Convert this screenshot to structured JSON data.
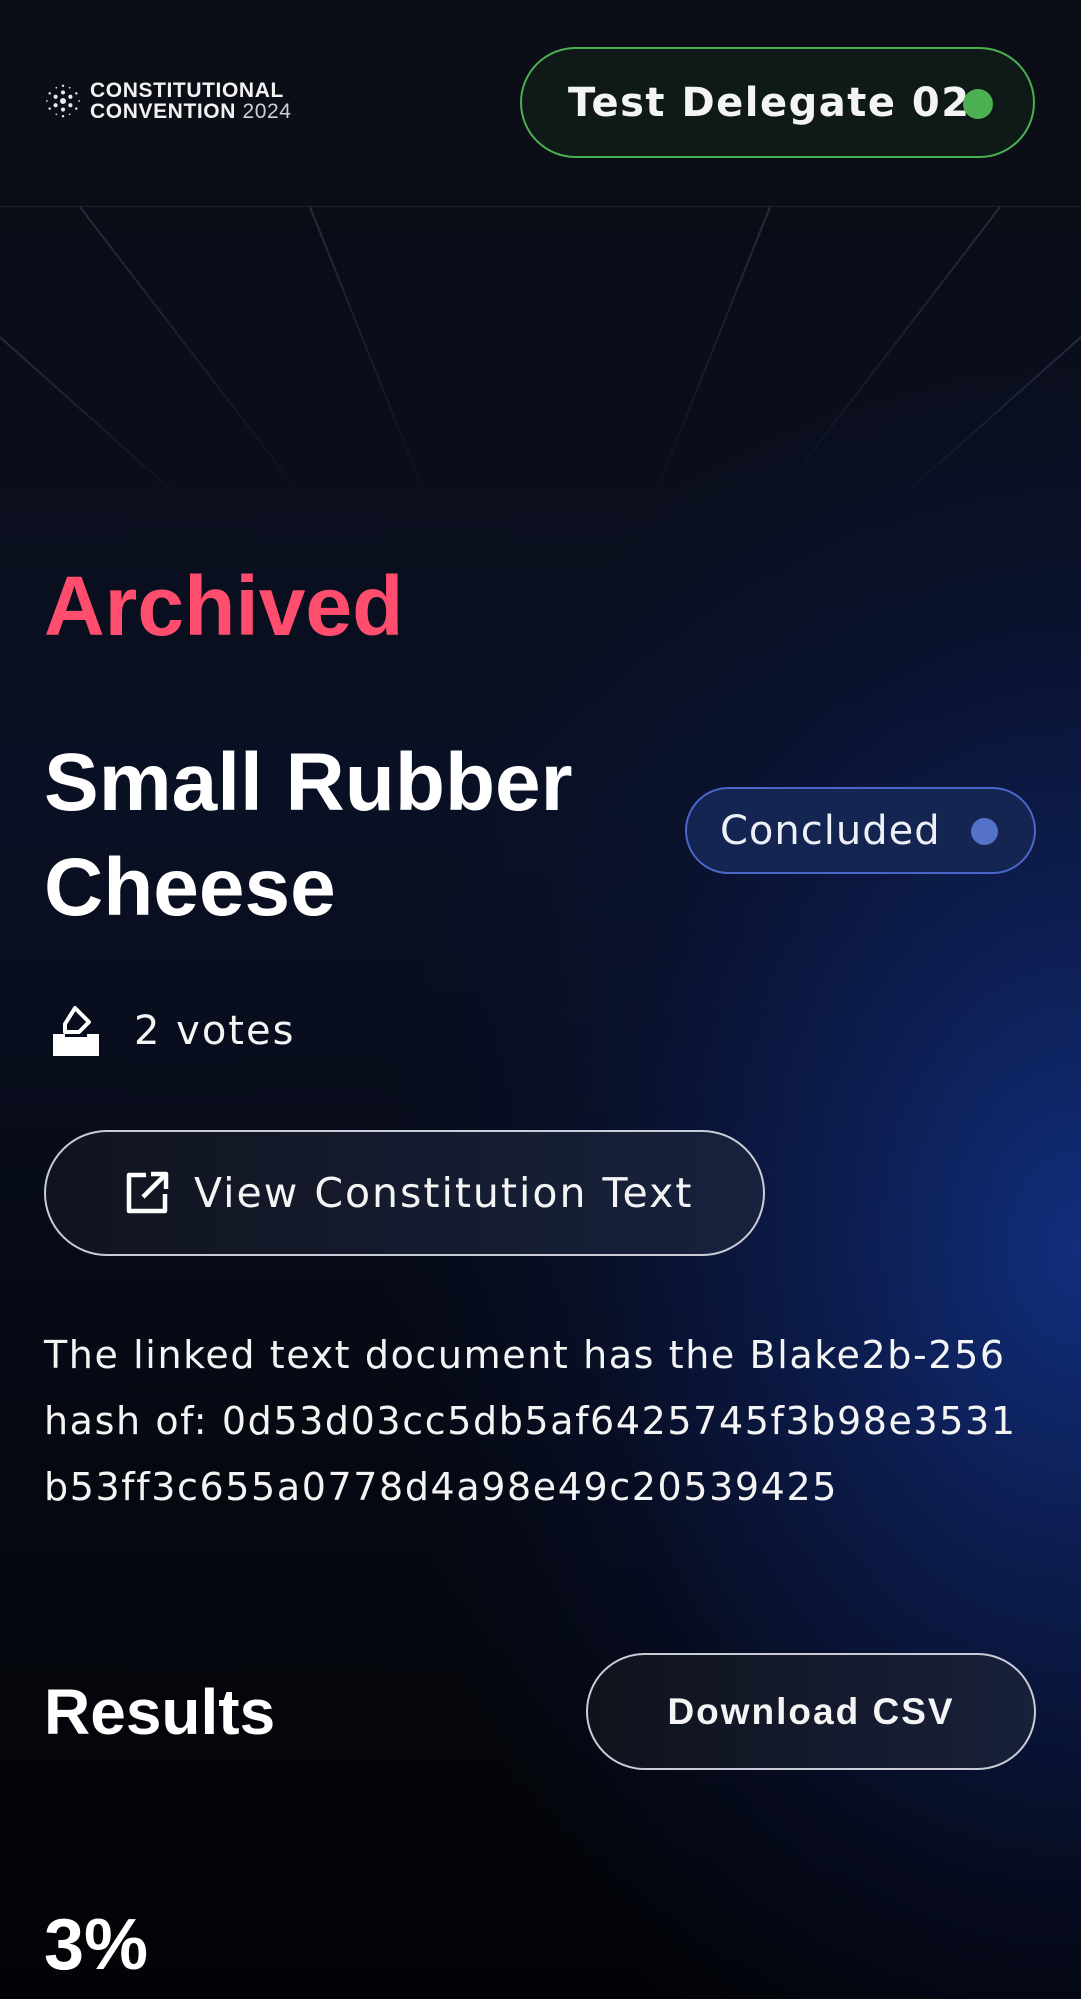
{
  "header": {
    "logo": {
      "line1": "CONSTITUTIONAL",
      "line2_word": "CONVENTION",
      "line2_year": "2024",
      "icon": "cardano-logo-icon"
    },
    "delegate": {
      "name": "Test Delegate 02",
      "status_color": "#4caf50",
      "status_icon": "online-status-dot"
    }
  },
  "proposal": {
    "state_label": "Archived",
    "title": "Small Rubber Cheese",
    "status_badge": {
      "label": "Concluded",
      "dot_color": "#5572c9"
    },
    "votes": {
      "icon": "ballot-box-icon",
      "label": "2 votes"
    },
    "view_text_button": {
      "icon": "external-link-icon",
      "label": "View Constitution Text"
    },
    "hash_note": "The linked text document has the Blake2b-256 hash of: 0d53d03cc5db5af6425745f3b98e3531b53ff3c655a0778d4a98e49c20539425"
  },
  "results": {
    "heading": "Results",
    "download_button": "Download CSV",
    "first_percentage": "3%"
  },
  "colors": {
    "archived": "#ff4d6d",
    "accent_green": "#4caf50",
    "badge_blue": "#142551",
    "background": "#06080f"
  }
}
